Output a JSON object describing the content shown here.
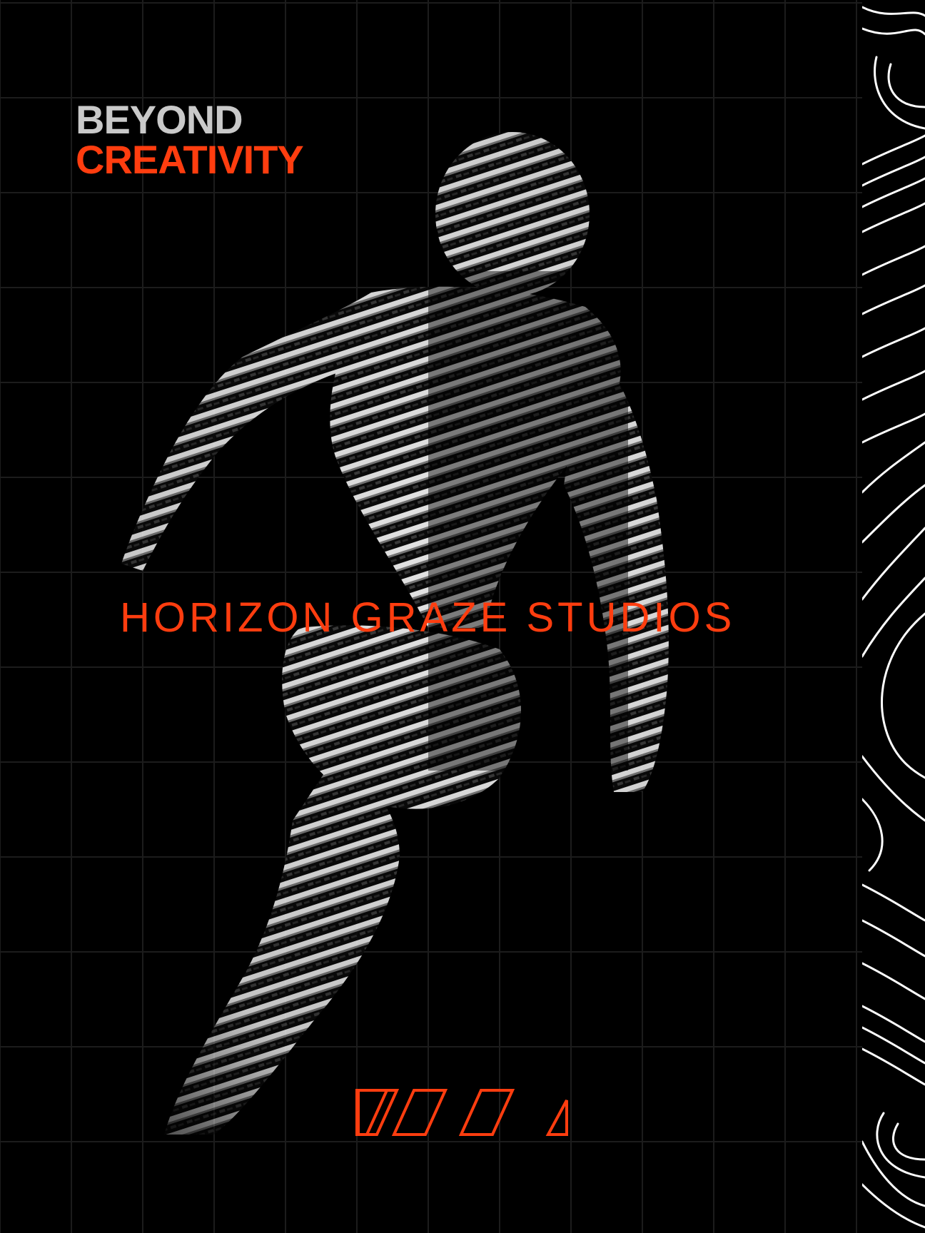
{
  "headline": {
    "line1": "BEYOND",
    "line2": "CREATIVITY"
  },
  "studio_name": "HORIZON GRAZE STUDIOS",
  "colors": {
    "background": "#000000",
    "accent": "#ff3d0f",
    "headline_gray": "#c9c9c9",
    "grid": "#1c1c1c",
    "topo_lines": "#ffffff"
  },
  "graphics": {
    "figure": "voxel-running-figure",
    "logo": "parallelogram-stripes-logo",
    "side_panel": "topographic-contour-pattern"
  }
}
